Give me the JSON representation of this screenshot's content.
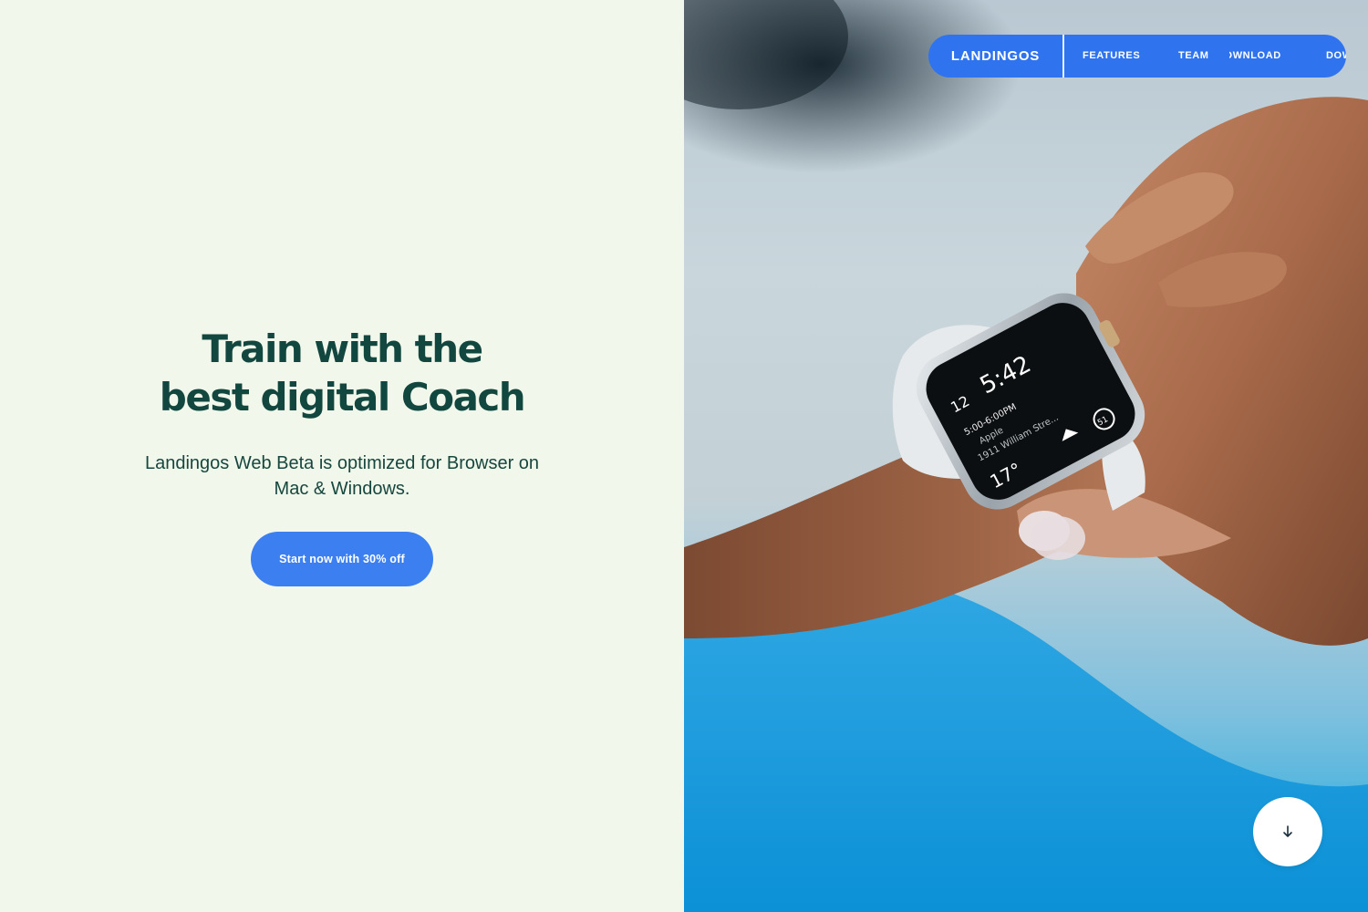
{
  "hero": {
    "title_line1": "Train with the",
    "title_line2": "best digital Coach",
    "subtitle": "Landingos Web Beta is optimized for Browser on Mac & Windows.",
    "cta_label": "Start now with 30% off"
  },
  "nav": {
    "brand": "LANDINGOS",
    "links": [
      "FEATURES",
      "TEAM",
      "DOWNLOAD"
    ]
  },
  "watch": {
    "time": "5:42",
    "date": "12",
    "event_time": "5:00-6:00PM",
    "event_title": "Apple",
    "event_location": "1911 William Stre...",
    "temperature": "17°",
    "activity": "51"
  },
  "scroll": {
    "icon": "arrow-down-icon"
  },
  "colors": {
    "background": "#f1f7ea",
    "heading": "#12473f",
    "accent": "#3b7ff0",
    "nav": "#2f74ee"
  }
}
